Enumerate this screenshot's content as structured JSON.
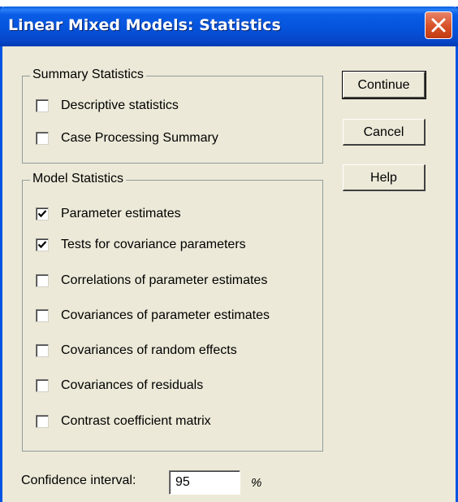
{
  "window": {
    "title": "Linear Mixed Models: Statistics"
  },
  "summary_group": {
    "legend": "Summary Statistics",
    "items": [
      {
        "label": "Descriptive statistics",
        "checked": false
      },
      {
        "label": "Case Processing Summary",
        "checked": false
      }
    ]
  },
  "model_group": {
    "legend": "Model Statistics",
    "items": [
      {
        "label": "Parameter estimates",
        "checked": true
      },
      {
        "label": "Tests for covariance parameters",
        "checked": true
      },
      {
        "label": "Correlations of parameter estimates",
        "checked": false
      },
      {
        "label": "Covariances of parameter estimates",
        "checked": false
      },
      {
        "label": "Covariances of random effects",
        "checked": false
      },
      {
        "label": "Covariances of residuals",
        "checked": false
      },
      {
        "label": "Contrast coefficient matrix",
        "checked": false
      }
    ]
  },
  "buttons": {
    "continue": "Continue",
    "cancel": "Cancel",
    "help": "Help"
  },
  "confidence": {
    "label": "Confidence interval:",
    "value": "95",
    "unit": "%"
  },
  "icons": {
    "close": "close-icon",
    "check": "checkmark-icon"
  },
  "colors": {
    "titlebar": "#0553dc",
    "close_button": "#d9542c",
    "dialog_bg": "#ece9d8"
  }
}
